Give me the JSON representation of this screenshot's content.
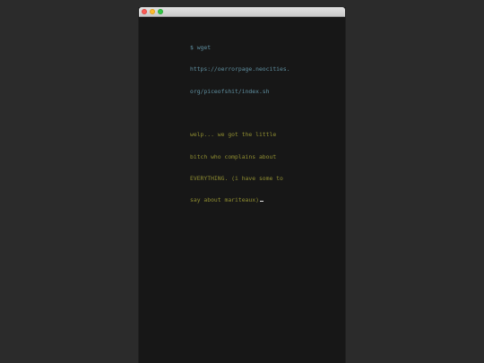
{
  "window": {
    "controls": [
      "close",
      "minimize",
      "zoom"
    ]
  },
  "terminal": {
    "command_lines": [
      "$ wget",
      "https://oerrorpage.neocities.",
      "org/piceofshit/index.sh"
    ],
    "output_lines": [
      "welp... we got the little",
      "bitch who complains about",
      "EVERYTHING. (i have some to",
      "say about mariteaux)"
    ]
  },
  "colors": {
    "desktop": "#2b2b2b",
    "terminal_bg": "#171717",
    "command_text": "#5f8fa0",
    "output_text": "#8f8d31"
  }
}
